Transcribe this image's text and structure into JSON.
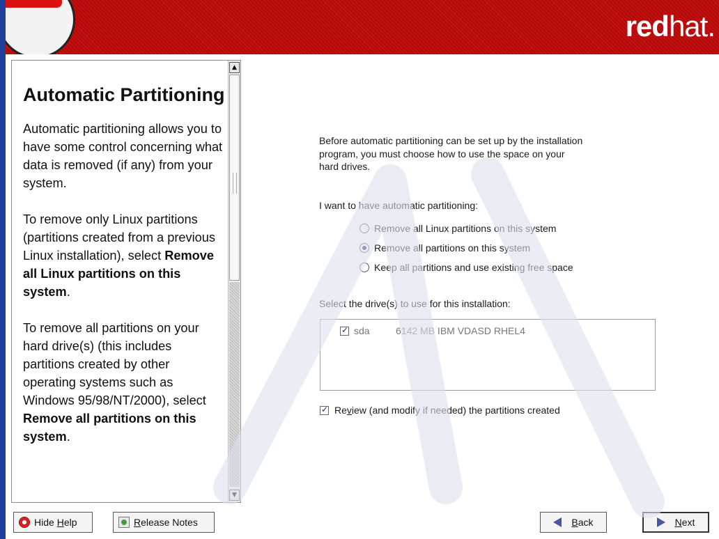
{
  "header": {
    "brand_bold": "red",
    "brand_light": "hat."
  },
  "help": {
    "title": "Automatic Partitioning",
    "para1": "Automatic partitioning allows you to have some control concerning what data is removed (if any) from your system.",
    "para2_pre": "To remove only Linux partitions (partitions created from a previous Linux installation), select ",
    "para2_bold": "Remove all Linux partitions on this system",
    "para2_post": ".",
    "para3_pre": "To remove all partitions on your hard drive(s) (this includes partitions created by other operating systems such as Windows 95/98/NT/2000), select ",
    "para3_bold": "Remove all partitions on this system",
    "para3_post": "."
  },
  "main": {
    "intro": "Before automatic partitioning can be set up by the installation program, you must choose how to use the space on your hard drives.",
    "want_label": "I want to have automatic partitioning:",
    "options": [
      {
        "label": "Remove all Linux partitions on this system",
        "selected": false
      },
      {
        "label": "Remove all partitions on this system",
        "selected": true
      },
      {
        "label": "Keep all partitions and use existing free space",
        "selected": false
      }
    ],
    "drives_label": "Select the drive(s) to use for this installation:",
    "drives": [
      {
        "name": "sda",
        "description": "6142 MB  IBM VDASD RHEL4",
        "checked": true
      }
    ],
    "review_pre": "Re",
    "review_u": "v",
    "review_post": "iew (and modify if needed) the partitions created",
    "review_checked": true
  },
  "buttons": {
    "hide_help": {
      "pre": "Hide ",
      "u": "H",
      "post": "elp"
    },
    "release_notes": {
      "pre": "",
      "u": "R",
      "post": "elease Notes"
    },
    "back": {
      "pre": "",
      "u": "B",
      "post": "ack"
    },
    "next": {
      "pre": "",
      "u": "N",
      "post": "ext"
    }
  },
  "colors": {
    "banner_red": "#c41010",
    "edge_blue": "#1f3f9a",
    "accent_blue": "#4a55a0"
  }
}
